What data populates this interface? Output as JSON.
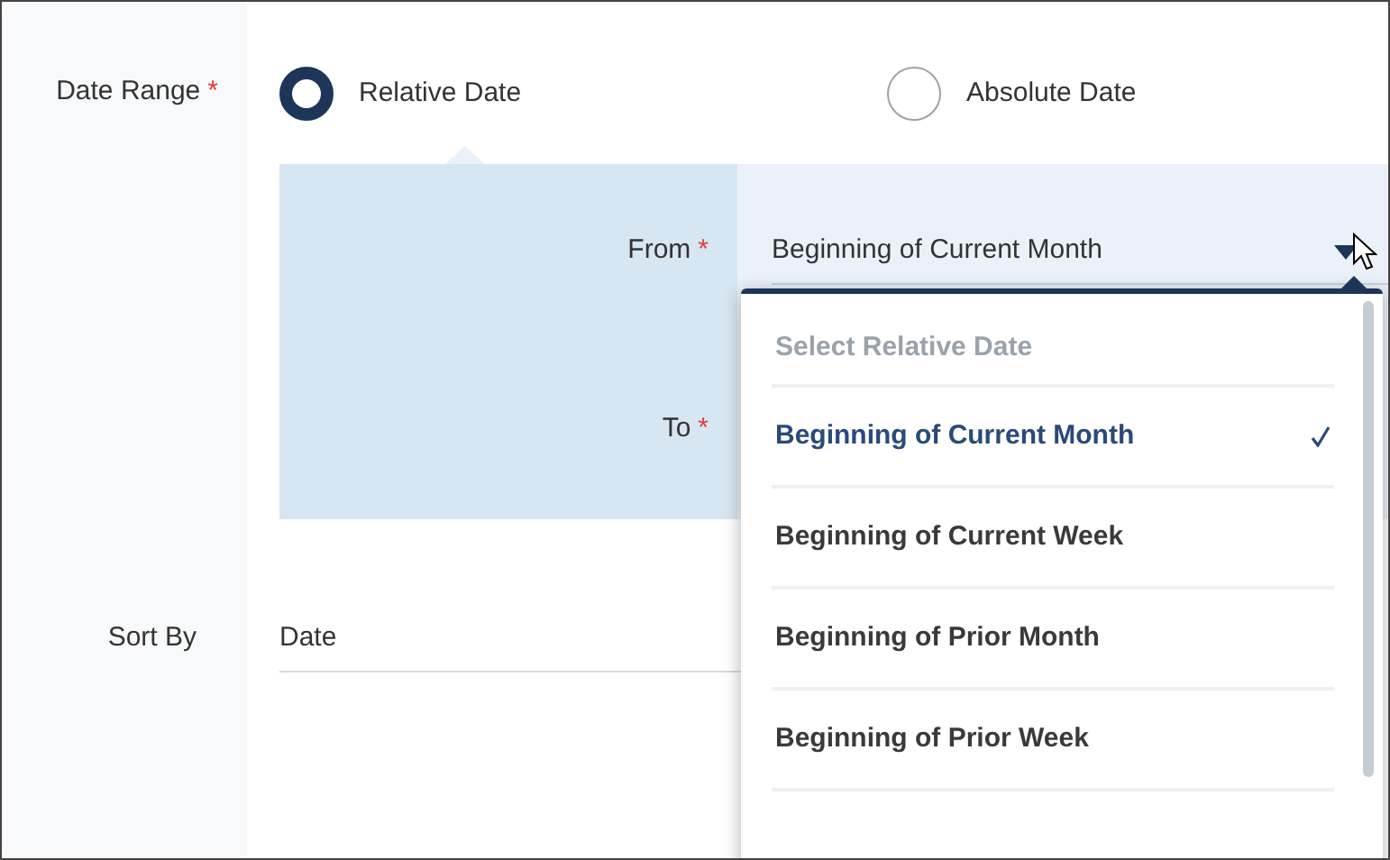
{
  "date_range": {
    "label": "Date Range",
    "required_mark": "*",
    "options": [
      {
        "label": "Relative Date",
        "selected": true
      },
      {
        "label": "Absolute Date",
        "selected": false
      }
    ]
  },
  "from": {
    "label": "From",
    "required_mark": "*",
    "value": "Beginning of Current Month",
    "expanded": true
  },
  "to": {
    "label": "To",
    "required_mark": "*"
  },
  "dropdown": {
    "header": "Select Relative Date",
    "items": [
      {
        "label": "Beginning of Current Month",
        "selected": true
      },
      {
        "label": "Beginning of Current Week",
        "selected": false
      },
      {
        "label": "Beginning of Prior Month",
        "selected": false
      },
      {
        "label": "Beginning of Prior Week",
        "selected": false
      }
    ]
  },
  "sort_by": {
    "label": "Sort By",
    "value": "Date"
  }
}
